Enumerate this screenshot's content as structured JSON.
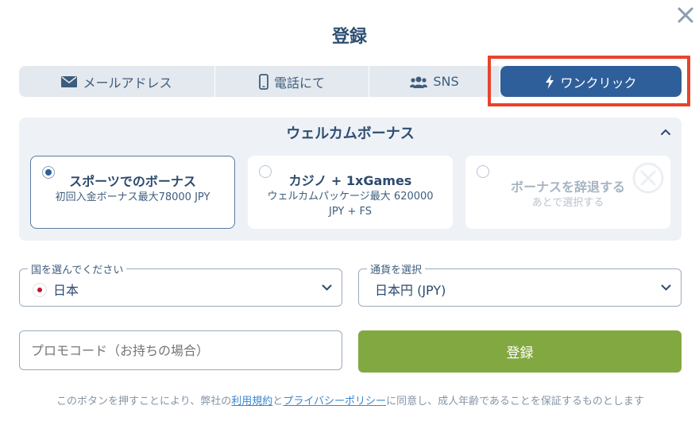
{
  "title": "登録",
  "tabs": [
    {
      "label": "メールアドレス",
      "icon": "envelope-icon"
    },
    {
      "label": "電話にて",
      "icon": "phone-icon"
    },
    {
      "label": "SNS",
      "icon": "users-icon"
    },
    {
      "label": "ワンクリック",
      "icon": "lightning-icon",
      "active": true
    }
  ],
  "bonus": {
    "header": "ウェルカムボーナス",
    "cards": [
      {
        "title": "スポーツでのボーナス",
        "subtitle": "初回入金ボーナス最大78000 JPY",
        "selected": true
      },
      {
        "title": "カジノ + 1xGames",
        "subtitle": "ウェルカムパッケージ最大 620000 JPY + FS",
        "selected": false
      },
      {
        "title": "ボーナスを辞退する",
        "subtitle": "あとで選択する",
        "selected": false
      }
    ]
  },
  "country": {
    "label": "国を選んでください",
    "value": "日本"
  },
  "currency": {
    "label": "通貨を選択",
    "value": "日本円 (JPY)"
  },
  "promo": {
    "placeholder": "プロモコード（お持ちの場合）"
  },
  "submit_label": "登録",
  "legal": {
    "part1": "このボタンを押すことにより、弊社の",
    "terms_link": "利用規約",
    "part2": "と",
    "privacy_link": "プライバシーポリシー",
    "part3": "に同意し、成人年齢であることを保証するものとします"
  },
  "colors": {
    "accent": "#2f5f9b",
    "submit": "#82a941",
    "highlight": "#e8432c",
    "link": "#3a86d1"
  }
}
